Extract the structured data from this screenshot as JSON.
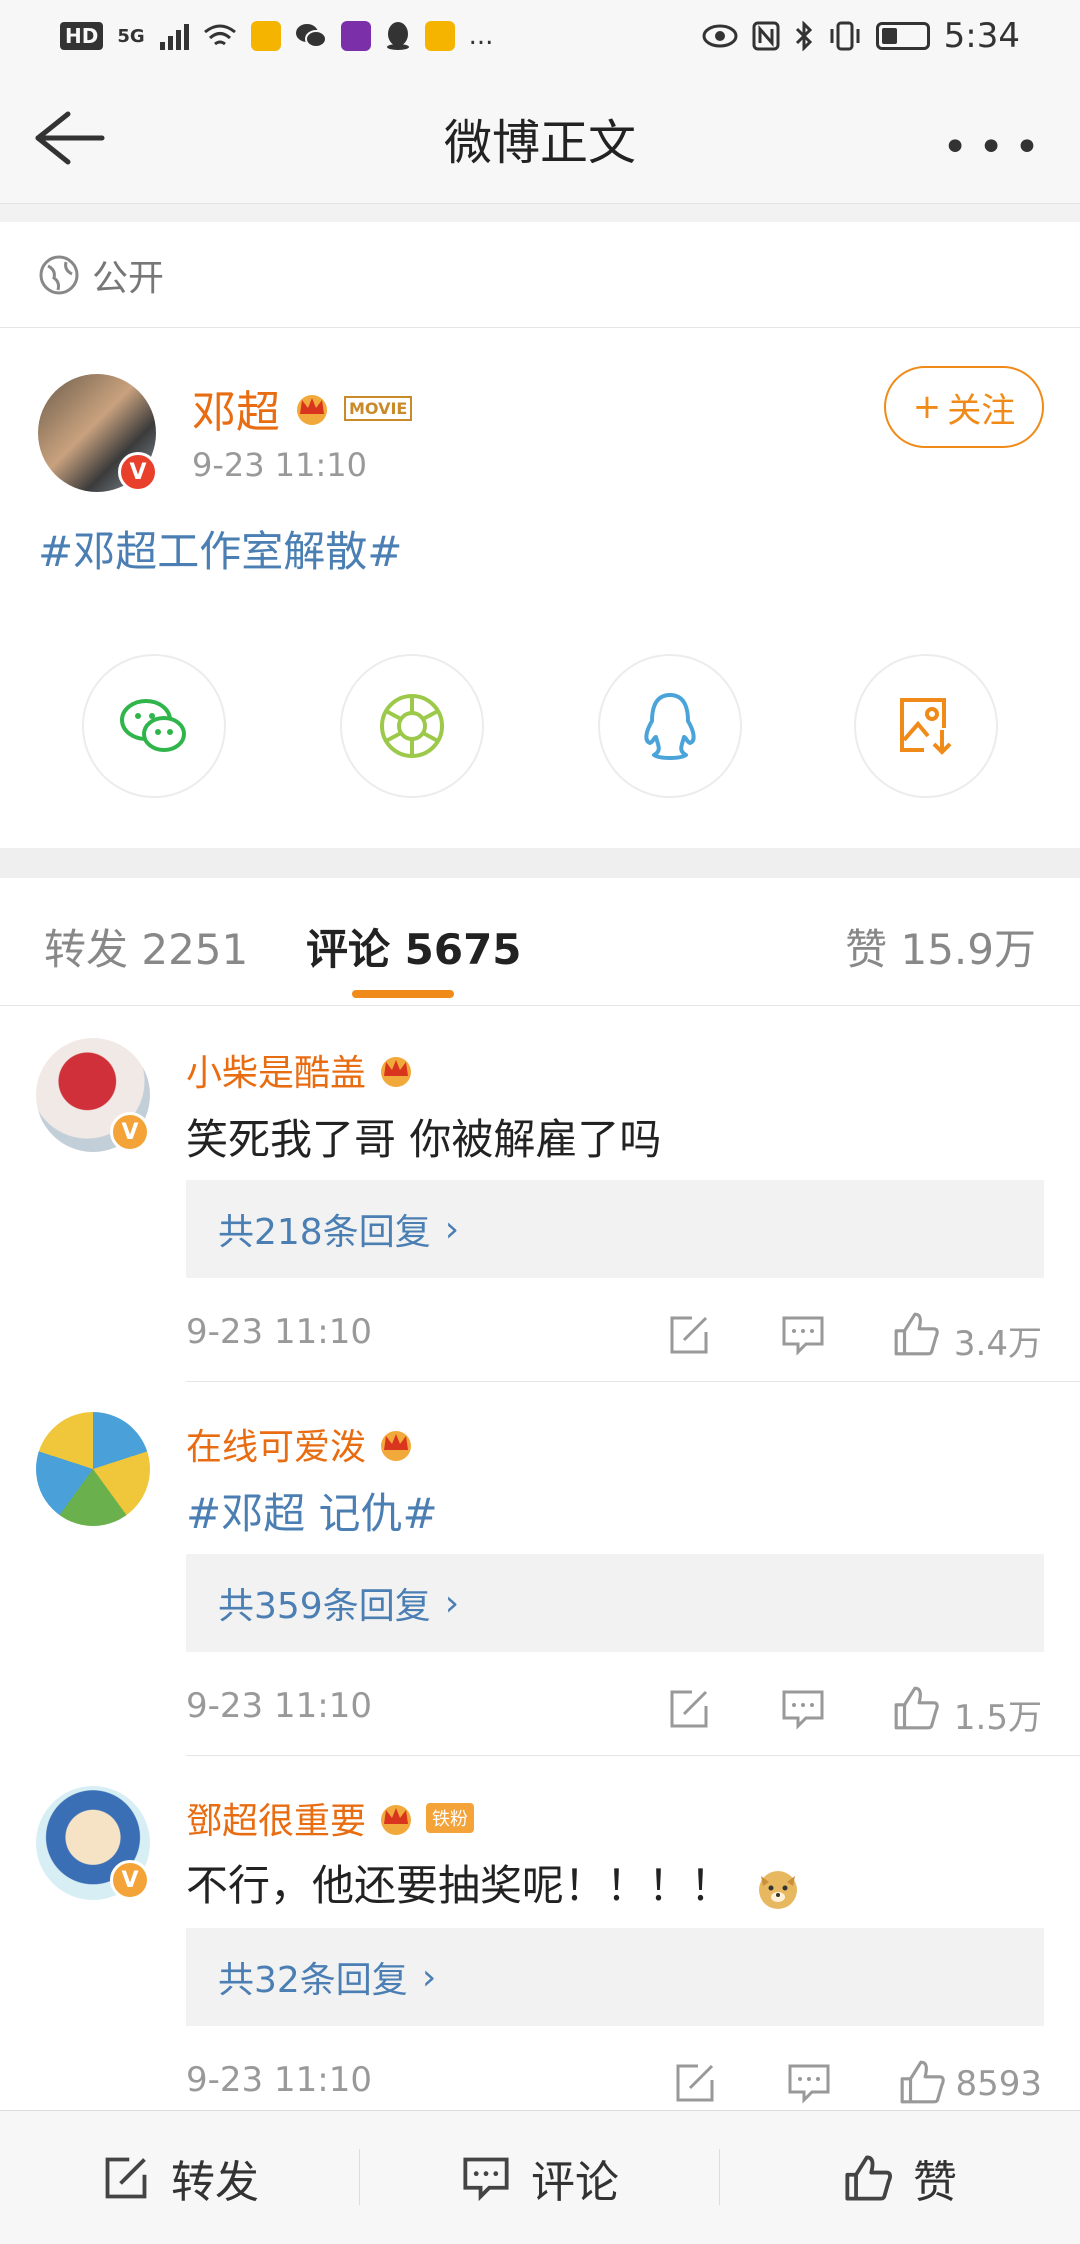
{
  "status_bar": {
    "time": "5:34",
    "left_indicators": [
      "HD",
      "5G",
      "signal",
      "wifi",
      "mail",
      "wechat",
      "app",
      "qq",
      "mail",
      "..."
    ],
    "battery_level": 0.35
  },
  "navbar": {
    "title": "微博正文",
    "more": "•••"
  },
  "visibility": {
    "label": "公开"
  },
  "post": {
    "author": "邓超",
    "badge": "MOVIE",
    "verified": "V",
    "time": "9-23 11:10",
    "follow_label": "关注",
    "follow_plus": "+",
    "topic": "#邓超工作室解散#",
    "share_icons": [
      "wechat-icon",
      "moments-icon",
      "qq-icon",
      "save-image-icon"
    ]
  },
  "tabs": [
    {
      "label": "转发 2251"
    },
    {
      "label": "评论 5675"
    },
    {
      "label": "赞 15.9万"
    }
  ],
  "comments": [
    {
      "name": "小柴是酷盖",
      "text": "笑死我了哥 你被解雇了吗",
      "replies": "共218条回复",
      "time": "9-23 11:10",
      "likes": "3.4万",
      "badge": ""
    },
    {
      "name": "在线可爱泼",
      "text": "#邓超 记仇#",
      "replies": "共359条回复",
      "time": "9-23 11:10",
      "likes": "1.5万",
      "badge": ""
    },
    {
      "name": "鄧超很重要",
      "text": "不行，他还要抽奖呢！！！！",
      "replies": "共32条回复",
      "time": "9-23 11:10",
      "likes": "8593",
      "badge": "铁粉"
    }
  ],
  "bottom_bar": {
    "repost": "转发",
    "comment": "评论",
    "like": "赞"
  },
  "colors": {
    "accent": "#f08a18",
    "name": "#e86d12",
    "link": "#4b7fb3"
  }
}
